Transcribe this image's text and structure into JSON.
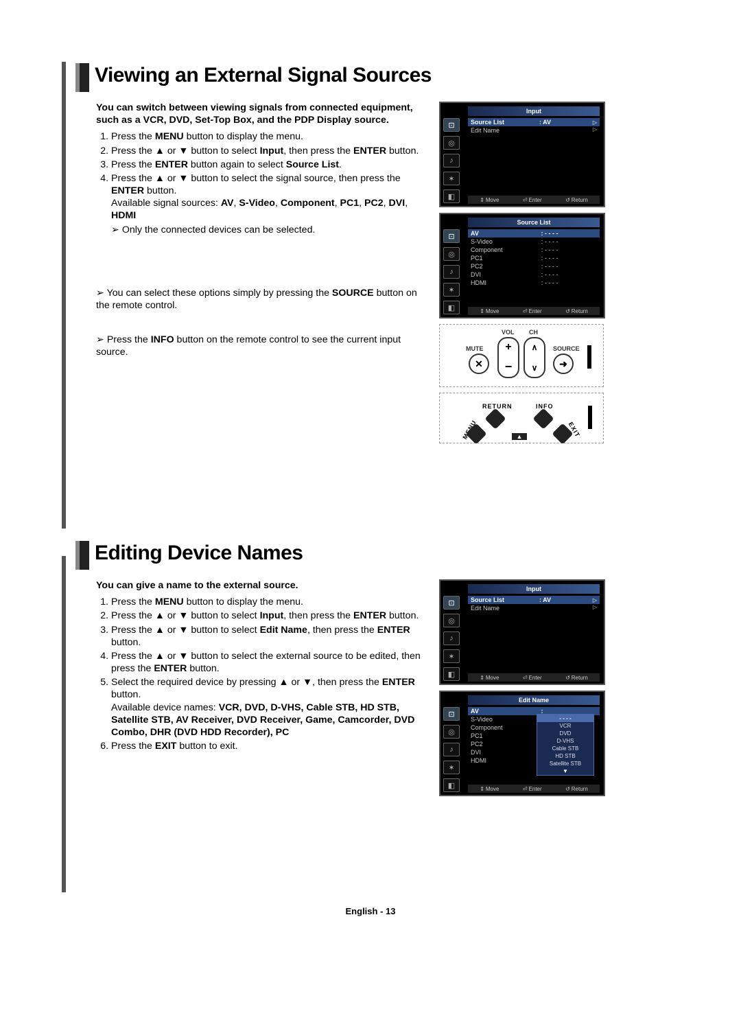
{
  "section1": {
    "title": "Viewing an External Signal Sources",
    "intro": "You can switch between viewing signals from connected equipment, such as a VCR, DVD, Set-Top Box, and the PDP Display source.",
    "steps": {
      "s1_a": "Press the ",
      "s1_b": "MENU",
      "s1_c": " button to display the menu.",
      "s2_a": "Press the ▲ or ▼ button to select ",
      "s2_b": "Input",
      "s2_c": ", then press the ",
      "s2_d": "ENTER",
      "s2_e": " button.",
      "s3_a": "Press the ",
      "s3_b": "ENTER",
      "s3_c": " button again to select ",
      "s3_d": "Source List",
      "s3_e": ".",
      "s4_a": "Press the ▲ or ▼ button to select the signal source, then press the ",
      "s4_b": "ENTER",
      "s4_c": " button.",
      "s4_avail_a": "Available signal sources: ",
      "s4_avail_b": "AV",
      "s4_sep": ", ",
      "s4_avail_c": "S-Video",
      "s4_avail_d": "Component",
      "s4_avail_e": "PC1",
      "s4_avail_f": "PC2",
      "s4_avail_g": "DVI",
      "s4_avail_h": "HDMI"
    },
    "note1": "Only the connected devices can be selected.",
    "note2_a": "You can select these options simply by pressing the ",
    "note2_b": "SOURCE",
    "note2_c": " button on the remote control.",
    "note3_a": "Press the ",
    "note3_b": "INFO",
    "note3_c": " button on the remote control to see the current input source."
  },
  "section2": {
    "title": "Editing Device Names",
    "intro": "You can give a name to the external source.",
    "steps": {
      "s1_a": "Press the ",
      "s1_b": "MENU",
      "s1_c": " button to display the menu.",
      "s2_a": "Press the ▲ or ▼ button to select ",
      "s2_b": "Input",
      "s2_c": ", then press the ",
      "s2_d": "ENTER",
      "s2_e": " button.",
      "s3_a": "Press the ▲ or ▼ button to select ",
      "s3_b": "Edit Name",
      "s3_c": ", then press the ",
      "s3_d": "ENTER",
      "s3_e": " button.",
      "s4_a": "Press the ▲ or ▼ button to select the external source to be edited, then press the ",
      "s4_b": "ENTER",
      "s4_c": " button.",
      "s5_a": "Select the required device by pressing ▲ or ▼, then press the ",
      "s5_b": "ENTER",
      "s5_c": " button.",
      "s5_avail_a": "Available device names: ",
      "s5_list": "VCR, DVD, D-VHS, Cable STB, HD STB, Satellite STB, AV Receiver, DVD Receiver, Game, Camcorder, DVD Combo, DHR (DVD HDD Recorder), PC",
      "s6_a": "Press the ",
      "s6_b": "EXIT",
      "s6_c": " button to exit."
    }
  },
  "osd": {
    "input_title": "Input",
    "source_list_title": "Source List",
    "edit_name_title": "Edit Name",
    "source_list": "Source List",
    "edit_name": "Edit Name",
    "av_val": ": AV",
    "blank": "- - - -",
    "sources": {
      "av": "AV",
      "svideo": "S-Video",
      "component": "Component",
      "pc1": "PC1",
      "pc2": "PC2",
      "dvi": "DVI",
      "hdmi": "HDMI"
    },
    "footer": {
      "move": "Move",
      "enter": "Enter",
      "return": "Return"
    },
    "popup": {
      "blank": "- - - -",
      "vcr": "VCR",
      "dvd": "DVD",
      "dvhs": "D-VHS",
      "cable": "Cable STB",
      "hd": "HD STB",
      "sat": "Satellite STB",
      "arrow": "▼"
    }
  },
  "remote": {
    "vol": "VOL",
    "ch": "CH",
    "mute": "MUTE",
    "source": "SOURCE",
    "return": "RETURN",
    "info": "INFO",
    "menu": "MENU",
    "exit": "EXIT"
  },
  "footer": "English - 13"
}
